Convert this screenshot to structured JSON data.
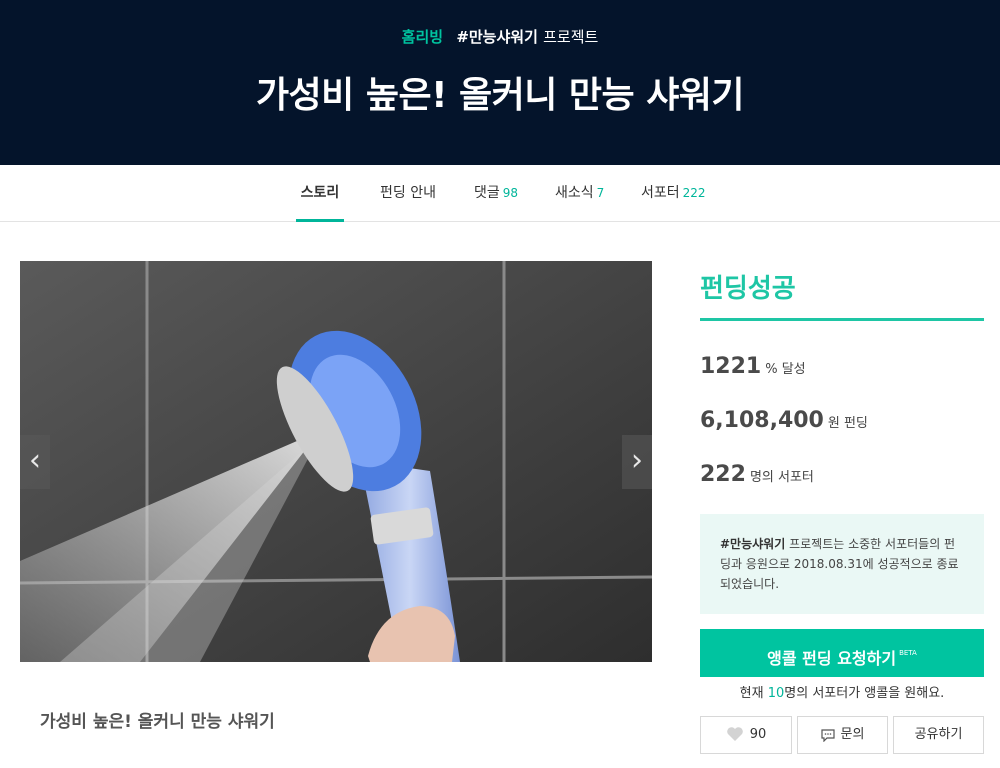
{
  "header": {
    "brand": "홈리빙",
    "hashtag": "#만능샤워기",
    "project_word": "프로젝트",
    "title": "가성비 높은! 올커니 만능 샤워기"
  },
  "tabs": [
    {
      "label": "스토리",
      "count": ""
    },
    {
      "label": "펀딩 안내",
      "count": ""
    },
    {
      "label": "댓글",
      "count": "98"
    },
    {
      "label": "새소식",
      "count": "7"
    },
    {
      "label": "서포터",
      "count": "222"
    }
  ],
  "gallery": {
    "prev_arrow": "‹",
    "next_arrow": "›",
    "caption": "가성비 높은! 올커니 만능 샤워기"
  },
  "panel": {
    "status": "펀딩성공",
    "rate": {
      "value": "1221",
      "unit": "% 달성"
    },
    "amount": {
      "value": "6,108,400",
      "unit": "원 펀딩"
    },
    "supporters": {
      "value": "222",
      "unit": "명의 서포터"
    },
    "notice": {
      "hashtag": "#만능샤워기",
      "text_1": " 프로젝트는 소중한 서포터들의 펀딩과 응원으로 ",
      "date": "2018.08.31",
      "text_2": "에 성공적으로 종료되었습니다."
    },
    "encore_button": {
      "label": "앵콜 펀딩 요청하기",
      "badge": "BETA"
    },
    "encore_note": {
      "prefix": "현재 ",
      "count": "10",
      "suffix": "명의 서포터가 앵콜을 원해요."
    },
    "like_count": "90",
    "inquiry_label": "문의",
    "share_label": "공유하기"
  },
  "colors": {
    "header_bg": "#04142b",
    "accent": "#1ec6a5",
    "button": "#00c4a0",
    "notice_bg": "#eaf8f5"
  },
  "icons": [
    "heart-icon",
    "speech-bubble-icon",
    "chevron-left-icon",
    "chevron-right-icon"
  ]
}
